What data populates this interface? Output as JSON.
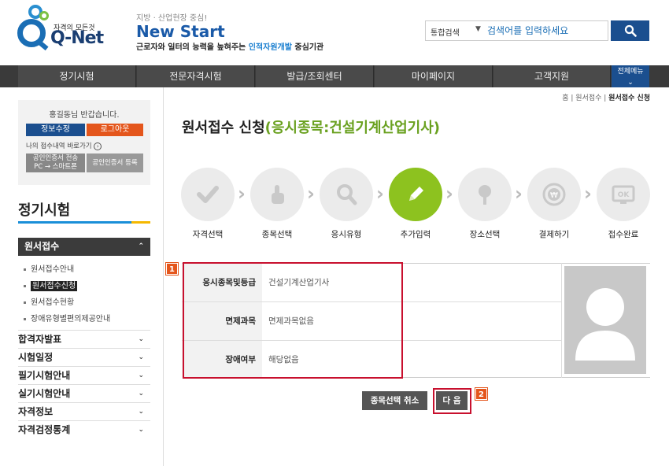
{
  "header": {
    "logo_small": "자격의 모든것",
    "logo_text": "Q-Net",
    "tagline": "지방 · 산업현장 중심!",
    "campaign": "New Start",
    "subtitle_pre": "근로자와 일터의 능력을 높혀주는 ",
    "subtitle_hl": "인적자원개발",
    "subtitle_post": " 중심기관"
  },
  "search": {
    "scope": "통합검색",
    "placeholder": "검색어를 입력하세요",
    "icon": "search-icon"
  },
  "gnb": {
    "items": [
      "정기시험",
      "전문자격시험",
      "발급/조회센터",
      "마이페이지",
      "고객지원"
    ],
    "all_menu": "전체메뉴"
  },
  "userbox": {
    "greeting": "홍길동님 반갑습니다.",
    "info_btn": "정보수정",
    "logout_btn": "로그아웃",
    "shortcut": "나의 접수내역 바로가기",
    "cert_send_1": "공인인증서 전송",
    "cert_send_2": "PC → 스마트폰",
    "cert_register": "공인인증서 등록"
  },
  "sidebar": {
    "title": "정기시험",
    "active_menu": "원서접수",
    "sub_items": [
      "원서접수안내",
      "원서접수신청",
      "원서접수현황",
      "장애유형별편의제공안내"
    ],
    "menus": [
      "합격자발표",
      "시험일정",
      "필기시험안내",
      "실기시험안내",
      "자격정보",
      "자격검정통계"
    ]
  },
  "breadcrumb": {
    "home": "홈",
    "parent": "원서접수",
    "current": "원서접수 신청"
  },
  "page": {
    "title": "원서접수 신청",
    "title_hl": "(응시종목:건설기계산업기사)"
  },
  "steps": [
    {
      "label": "자격선택",
      "icon": "check-icon",
      "active": false
    },
    {
      "label": "종목선택",
      "icon": "pointer-icon",
      "active": false
    },
    {
      "label": "응시유형",
      "icon": "magnifier-icon",
      "active": false
    },
    {
      "label": "추가입력",
      "icon": "pencil-icon",
      "active": true
    },
    {
      "label": "장소선택",
      "icon": "location-pin-icon",
      "active": false
    },
    {
      "label": "결제하기",
      "icon": "won-coin-icon",
      "active": false
    },
    {
      "label": "접수완료",
      "icon": "ok-monitor-icon",
      "active": false
    }
  ],
  "form": {
    "rows": [
      {
        "label": "응시종목및등급",
        "value": "건설기계산업기사"
      },
      {
        "label": "면제과목",
        "value": "면제과목없음"
      },
      {
        "label": "장애여부",
        "value": "해당없음"
      }
    ]
  },
  "annotations": {
    "badge1": "1",
    "badge2": "2"
  },
  "buttons": {
    "cancel": "종목선택 취소",
    "next": "다 음"
  },
  "colors": {
    "brand_blue": "#1b4f8f",
    "active_green": "#8dc21f",
    "highlight_red": "#c8102e",
    "badge_orange": "#e4561c"
  }
}
